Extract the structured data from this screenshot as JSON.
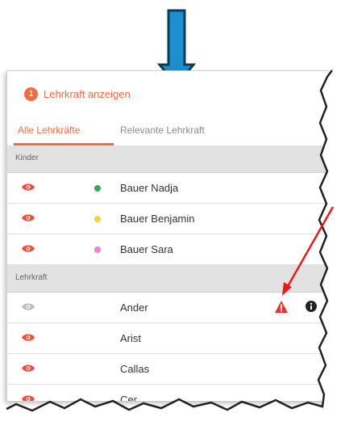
{
  "panel": {
    "step_number": "1",
    "title": "Lehrkraft anzeigen",
    "tabs": [
      {
        "label": "Alle Lehrkräfte",
        "active": true
      },
      {
        "label": "Relevante Lehrkraft",
        "active": false
      }
    ],
    "sections": [
      {
        "label": "Kinder",
        "rows": [
          {
            "name": "Bauer Nadja",
            "visible": true,
            "dot_color": "#3aa84a"
          },
          {
            "name": "Bauer Benjamin",
            "visible": true,
            "dot_color": "#f5d33a"
          },
          {
            "name": "Bauer Sara",
            "visible": true,
            "dot_color": "#f07fd8"
          }
        ]
      },
      {
        "label": "Lehrkraft",
        "rows": [
          {
            "name": "Ander",
            "visible": false,
            "warning_icon": "warning-icon",
            "info_icon": "info-icon"
          },
          {
            "name": "Arist",
            "visible": true
          },
          {
            "name": "Callas",
            "visible": true
          },
          {
            "name": "Cer",
            "visible": true
          }
        ]
      }
    ]
  },
  "colors": {
    "accent": "#f36c3f",
    "eye_visible": "#e8513c",
    "eye_hidden": "#bdbdbd",
    "blue_arrow": "#1b8fd0",
    "red_arrow": "#e41b1b"
  }
}
